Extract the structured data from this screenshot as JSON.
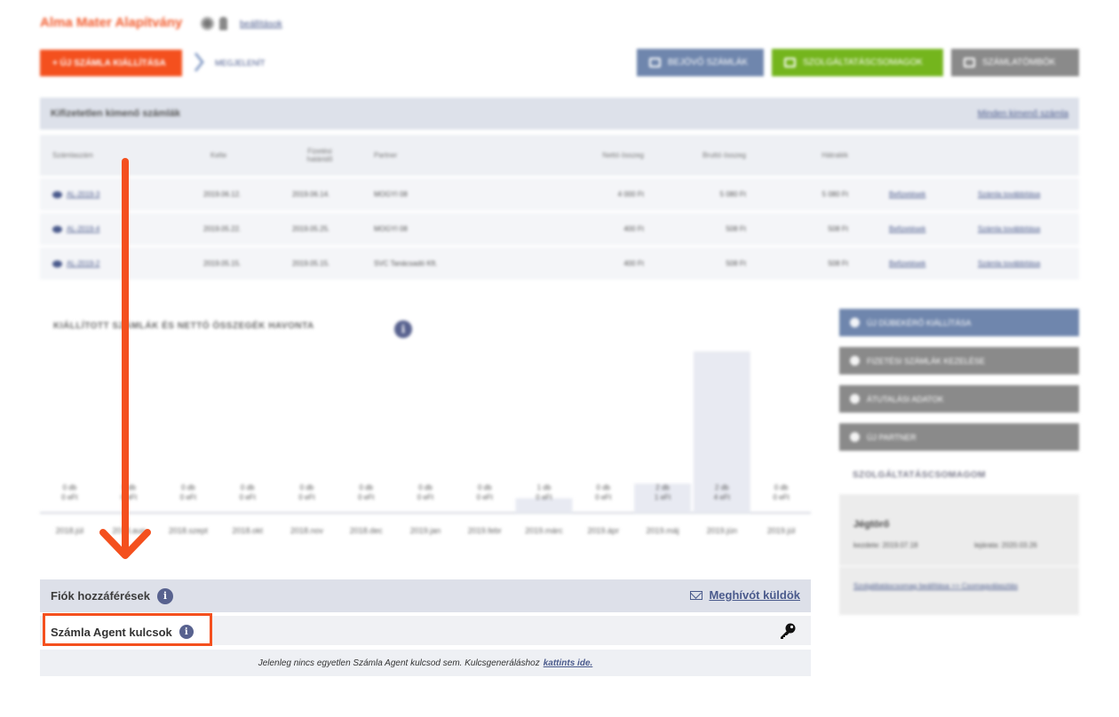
{
  "header": {
    "brand": "Alma Mater Alapítvány",
    "brand_link": "beállítások",
    "new_invoice_button": "+ ÚJ SZÁMLA KIÁLLÍTÁSA",
    "more_link": "MEGJELENÍT",
    "top_buttons": [
      {
        "label": "BEJÖVŐ SZÁMLÁK"
      },
      {
        "label": "SZOLGÁLTATÁSCSOMAGOK"
      },
      {
        "label": "SZÁMLATÖMBÖK"
      }
    ]
  },
  "invoices": {
    "title": "Kifizetetlen kimenő számlák",
    "all_link": "Minden kimenő számla",
    "columns": [
      "Számlaszám",
      "Kelte",
      "Fizetési határidő",
      "Partner",
      "Nettó összeg",
      "Bruttó összeg",
      "Hátralék"
    ],
    "rows": [
      {
        "num": "AL-2019-3",
        "date": "2019.06.12.",
        "due": "2019.06.14.",
        "partner": "MOGYI 08",
        "net": "4 000 Ft",
        "gross": "5 080 Ft",
        "rem": "5 080 Ft",
        "a1": "Befizetések",
        "a2": "Számla továbbítása"
      },
      {
        "num": "AL-2019-4",
        "date": "2019.05.22.",
        "due": "2019.05.25.",
        "partner": "MOGYI 08",
        "net": "400 Ft",
        "gross": "508 Ft",
        "rem": "508 Ft",
        "a1": "Befizetések",
        "a2": "Számla továbbítása"
      },
      {
        "num": "AL-2019-2",
        "date": "2019.05.15.",
        "due": "2019.05.15.",
        "partner": "SVC Tanácsadó Kft.",
        "net": "400 Ft",
        "gross": "508 Ft",
        "rem": "508 Ft",
        "a1": "Befizetések",
        "a2": "Számla továbbítása"
      }
    ]
  },
  "chart_panel": {
    "title": "KIÁLLÍTOTT SZÁMLÁK ÉS NETTÓ ÖSSZEGÉK HAVONTA"
  },
  "chart_data": {
    "type": "bar",
    "categories": [
      "2018.júl",
      "2018.aug",
      "2018.szept",
      "2018.okt",
      "2018.nov",
      "2018.dec",
      "2019.jan",
      "2019.febr",
      "2019.márc",
      "2019.ápr",
      "2019.máj",
      "2019.jún",
      "2019.júl"
    ],
    "labels_top": [
      "0 db",
      "0 db",
      "0 db",
      "0 db",
      "0 db",
      "0 db",
      "0 db",
      "0 db",
      "1 db",
      "0 db",
      "2 db",
      "2 db",
      "0 db"
    ],
    "labels_bottom": [
      "0 eFt",
      "0 eFt",
      "0 eFt",
      "0 eFt",
      "0 eFt",
      "0 eFt",
      "0 eFt",
      "0 eFt",
      "0 eFt",
      "0 eFt",
      "1 eFt",
      "4 eFt",
      "0 eFt"
    ],
    "values": [
      0,
      0,
      0,
      0,
      0,
      0,
      0,
      0,
      0.4,
      0,
      0.8,
      4.4,
      0
    ],
    "ylim": [
      0,
      4.4
    ]
  },
  "sidebar": {
    "buttons": [
      {
        "label": "ÚJ DÍJBEKÉRŐ KIÁLLÍTÁSA"
      },
      {
        "label": "FIZETÉSI SZÁMLÁK KEZELÉSE"
      },
      {
        "label": "ÁTUTALÁSI ADATOK"
      },
      {
        "label": "ÚJ PARTNER"
      }
    ],
    "services_title": "SZOLGÁLTATÁSCSOMAGOM",
    "service": {
      "name": "Jégtörő",
      "start": "kezdete: 2019.07.18",
      "end": "lejárata: 2020.03.26",
      "link": "Szolgáltatáscsomag beállítása >> Csomagválasztás"
    }
  },
  "account": {
    "title": "Fiók hozzáférések",
    "invite": "Meghívót küldök",
    "agent_label": "Számla Agent kulcsok",
    "empty_text": "Jelenleg nincs egyetlen Számla Agent kulcsod sem. Kulcsgeneráláshoz",
    "empty_link": "kattints ide."
  },
  "colors": {
    "accent": "#f4501e",
    "link": "#4a5a8c",
    "blue_button": "#6f86ad",
    "green_button": "#74b51d",
    "gray_button": "#8a8a8a"
  }
}
